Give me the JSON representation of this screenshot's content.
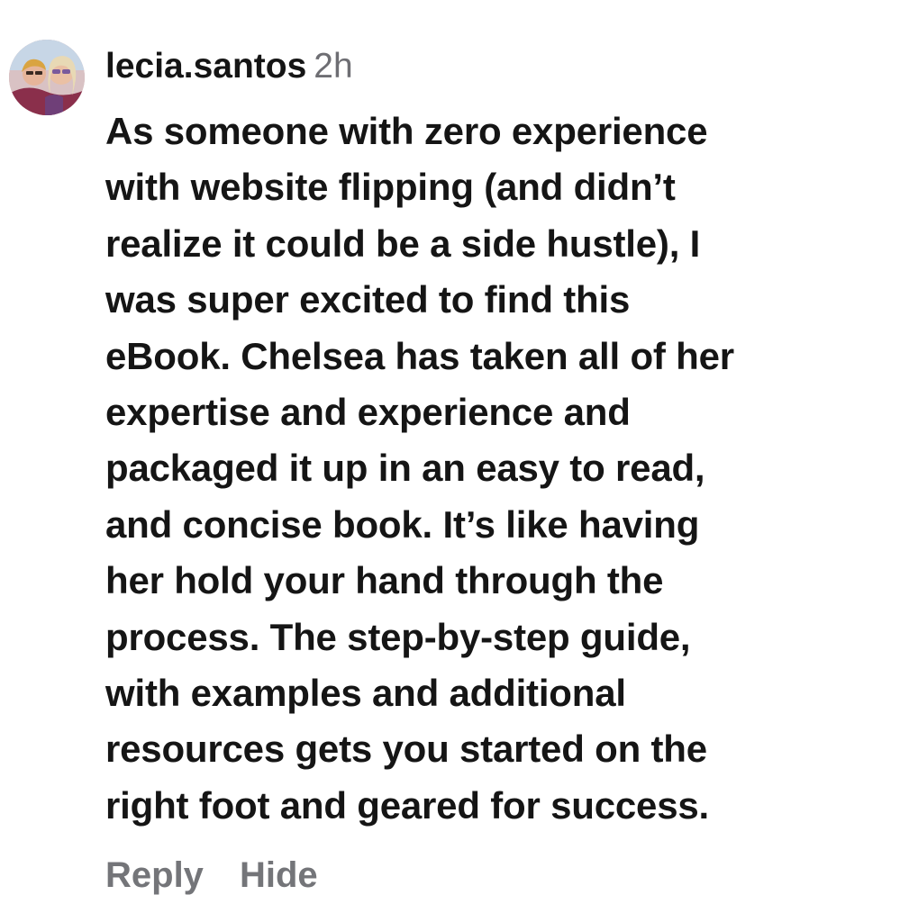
{
  "comment": {
    "username": "lecia.santos",
    "timestamp": "2h",
    "lines": [
      "As someone with zero experience",
      "with website flipping (and didn’t",
      "realize it could be a side hustle), I",
      "was super excited to find this",
      "eBook. Chelsea has taken all of her",
      "expertise and experience and",
      "packaged it up in an easy to read,",
      "and concise book. It’s like having",
      "her hold your hand through the",
      "process. The step-by-step guide,",
      "with examples and additional",
      "resources gets you started on the",
      "right foot and geared for success."
    ],
    "actions": {
      "reply": "Reply",
      "hide": "Hide"
    }
  },
  "colors": {
    "text": "#151515",
    "muted": "#6e6e73",
    "action": "#747579",
    "background": "#ffffff"
  },
  "icons": {
    "avatar": "profile-photo"
  }
}
